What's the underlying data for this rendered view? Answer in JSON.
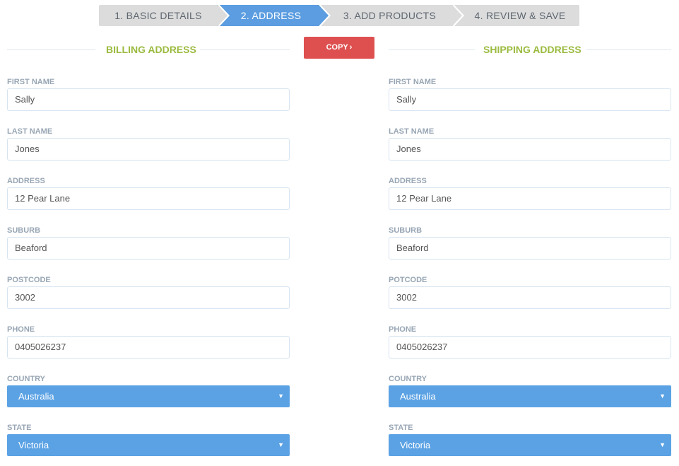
{
  "wizard": {
    "steps": [
      {
        "label": "1. BASIC DETAILS"
      },
      {
        "label": "2. ADDRESS"
      },
      {
        "label": "3. ADD PRODUCTS"
      },
      {
        "label": "4. REVIEW & SAVE"
      }
    ]
  },
  "copy_button": {
    "label": "COPY",
    "icon": "chevron-right-icon"
  },
  "billing": {
    "title": "BILLING ADDRESS",
    "fields": {
      "first_name": {
        "label": "FIRST NAME",
        "value": "Sally"
      },
      "last_name": {
        "label": "LAST NAME",
        "value": "Jones"
      },
      "address": {
        "label": "ADDRESS",
        "value": "12 Pear Lane"
      },
      "suburb": {
        "label": "SUBURB",
        "value": "Beaford"
      },
      "postcode": {
        "label": "POSTCODE",
        "value": "3002"
      },
      "phone": {
        "label": "PHONE",
        "value": "0405026237"
      },
      "country": {
        "label": "COUNTRY",
        "value": "Australia"
      },
      "state": {
        "label": "STATE",
        "value": "Victoria"
      }
    }
  },
  "shipping": {
    "title": "SHIPPING ADDRESS",
    "fields": {
      "first_name": {
        "label": "FIRST NAME",
        "value": "Sally"
      },
      "last_name": {
        "label": "LAST NAME",
        "value": "Jones"
      },
      "address": {
        "label": "ADDRESS",
        "value": "12 Pear Lane"
      },
      "suburb": {
        "label": "SUBURB",
        "value": "Beaford"
      },
      "postcode": {
        "label": "POTCODE",
        "value": "3002"
      },
      "phone": {
        "label": "PHONE",
        "value": "0405026237"
      },
      "country": {
        "label": "COUNTRY",
        "value": "Australia"
      },
      "state": {
        "label": "STATE",
        "value": "Victoria"
      }
    }
  },
  "colors": {
    "active_step": "#5b9de0",
    "inactive_step": "#dcdcdc",
    "heading": "#9bbb3f",
    "copy_button": "#de5050",
    "select": "#5ba2e4"
  }
}
